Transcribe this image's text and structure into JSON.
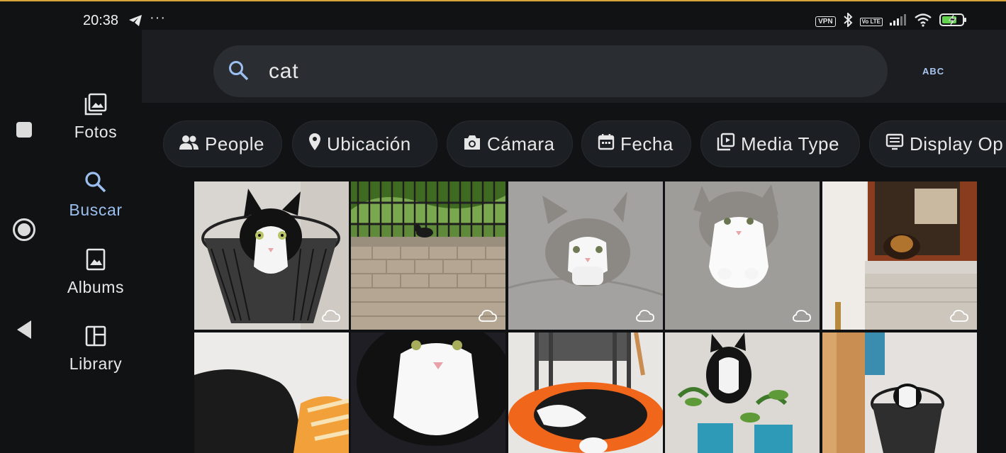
{
  "status_bar": {
    "time": "20:38",
    "notification_icons": [
      "telegram-icon",
      "more-dots-icon"
    ],
    "more": "···",
    "system_icons": [
      "vpn-badge",
      "bluetooth-icon",
      "volte-badge",
      "signal-icon",
      "wifi-icon",
      "battery-charging-icon"
    ],
    "vpn_label": "VPN",
    "volte_label": "Vo LTE"
  },
  "system_nav": {
    "buttons": [
      "recents-square-button",
      "home-circle-button",
      "back-triangle-button"
    ]
  },
  "nav": {
    "items": [
      {
        "label": "Fotos",
        "icon": "photos-icon",
        "active": false
      },
      {
        "label": "Buscar",
        "icon": "search-icon",
        "active": true
      },
      {
        "label": "Albums",
        "icon": "album-icon",
        "active": false
      },
      {
        "label": "Library",
        "icon": "library-icon",
        "active": false
      }
    ]
  },
  "search": {
    "value": "cat",
    "keyboard_mode_label": "ABC"
  },
  "chips": [
    {
      "label": "People",
      "icon": "people-icon"
    },
    {
      "label": "Ubicación",
      "icon": "location-pin-icon"
    },
    {
      "label": "Cámara",
      "icon": "camera-icon"
    },
    {
      "label": "Fecha",
      "icon": "calendar-icon"
    },
    {
      "label": "Media Type",
      "icon": "media-type-icon"
    },
    {
      "label": "Display Op",
      "icon": "display-options-icon"
    }
  ],
  "results": {
    "photos": [
      {
        "subject": "black-white cat in wire basket",
        "cloud": true
      },
      {
        "subject": "black cat on garden wall",
        "cloud": true
      },
      {
        "subject": "grey-white cat on pavement",
        "cloud": true
      },
      {
        "subject": "grey-white cat sitting",
        "cloud": true
      },
      {
        "subject": "cat peeking through window",
        "cloud": true
      },
      {
        "subject": "dark fabric close-up",
        "cloud": false
      },
      {
        "subject": "black-white cat close-up",
        "cloud": false
      },
      {
        "subject": "cat on orange chair",
        "cloud": false
      },
      {
        "subject": "cat with potted plants",
        "cloud": false
      },
      {
        "subject": "cat in basket by table",
        "cloud": false
      }
    ]
  },
  "colors": {
    "background": "#101214",
    "accent": "#9dbff0",
    "search_field": "#2a2d32",
    "chip": "#1c1f23"
  }
}
